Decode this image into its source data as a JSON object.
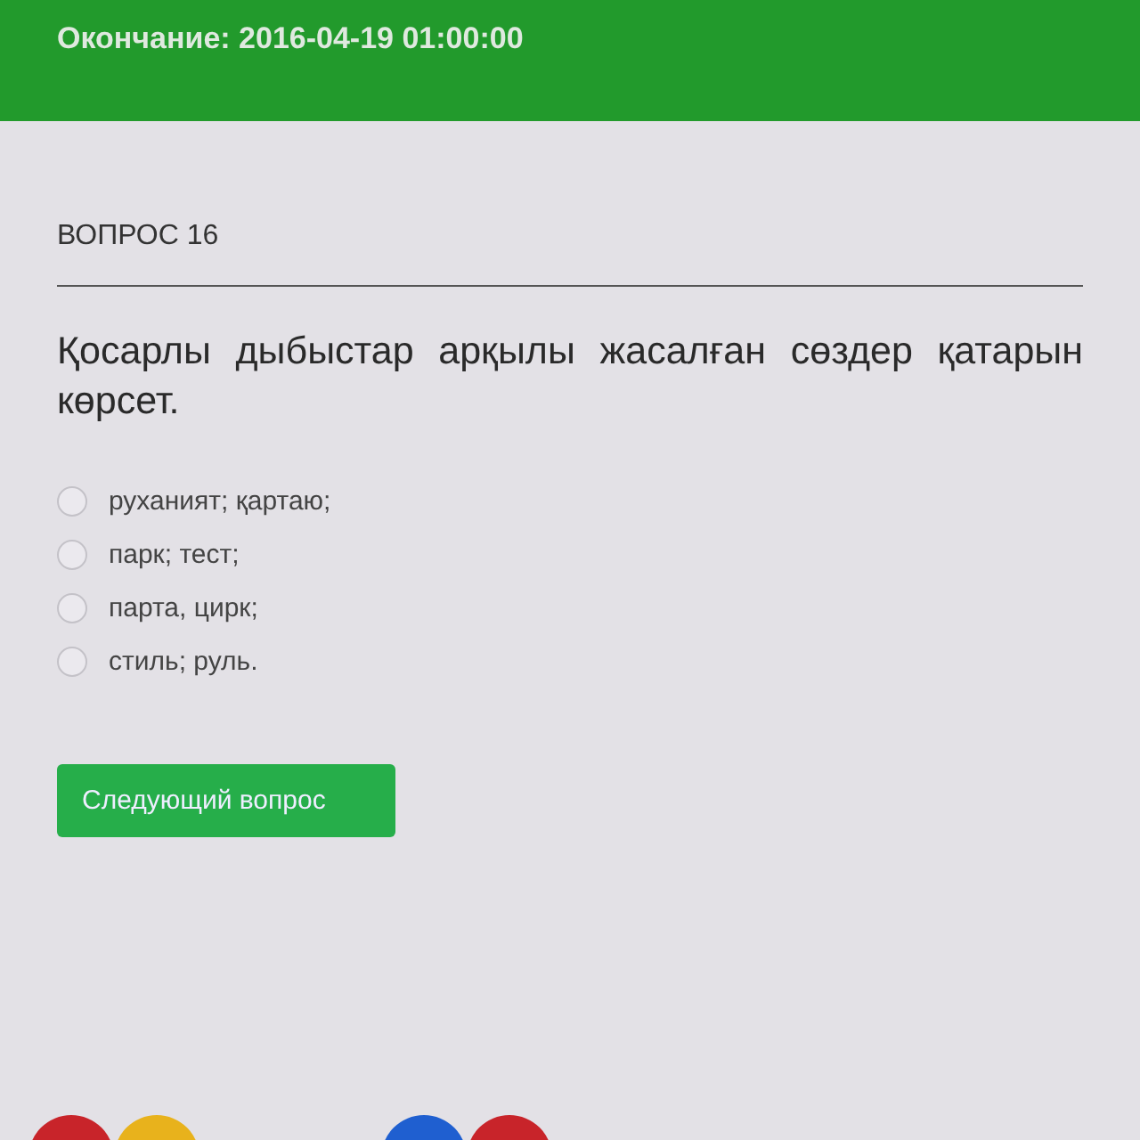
{
  "header": {
    "end_time": "Окончание: 2016-04-19 01:00:00"
  },
  "question": {
    "number": "ВОПРОС 16",
    "text": "Қосарлы дыбыстар арқылы жасалған сөздер қатарын көрсет.",
    "options": [
      {
        "label": "руханият; қартаю;",
        "selected": false
      },
      {
        "label": "парк; тест;",
        "selected": false
      },
      {
        "label": "парта, цирк;",
        "selected": false
      },
      {
        "label": "стиль; руль.",
        "selected": false
      }
    ]
  },
  "next_button": "Следующий вопрос"
}
